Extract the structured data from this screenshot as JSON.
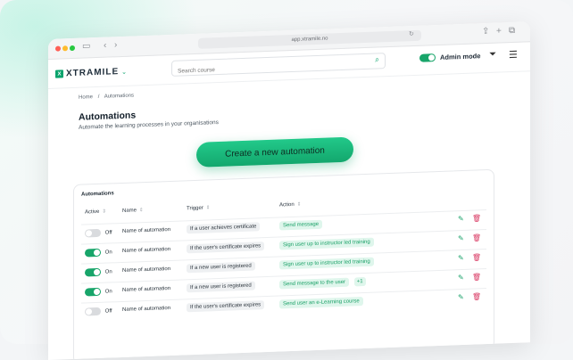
{
  "browser": {
    "url": "app.xtramile.no"
  },
  "header": {
    "logo_mark": "X",
    "logo_text": "XTRAMILE",
    "search_placeholder": "Search course",
    "admin_mode_label": "Admin mode",
    "admin_mode_on": true
  },
  "breadcrumb": {
    "home": "Home",
    "separator": "/",
    "current": "Automations"
  },
  "page": {
    "title": "Automations",
    "subtitle": "Automate the learning processes in your organisations",
    "create_button": "Create a new automation"
  },
  "table": {
    "title": "Automations",
    "columns": [
      "Active",
      "Name",
      "Trigger",
      "Action"
    ],
    "rows": [
      {
        "active": false,
        "active_label": "Off",
        "name": "Name of automation",
        "trigger": "If a user achieves certificate",
        "action": "Send message",
        "extra": ""
      },
      {
        "active": true,
        "active_label": "On",
        "name": "Name of automation",
        "trigger": "If the user's certificate expires",
        "action": "Sign user up to instructor led training",
        "extra": ""
      },
      {
        "active": true,
        "active_label": "On",
        "name": "Name of automation",
        "trigger": "If a new user is registered",
        "action": "Sign user up to instructor led training",
        "extra": ""
      },
      {
        "active": true,
        "active_label": "On",
        "name": "Name of automation",
        "trigger": "If a new user is registered",
        "action": "Send message to the user",
        "extra": "+1"
      },
      {
        "active": false,
        "active_label": "Off",
        "name": "Name of automation",
        "trigger": "If the user's certificate expires",
        "action": "Send user an e-Learning course",
        "extra": ""
      }
    ]
  },
  "colors": {
    "accent": "#18a56a",
    "delete": "#d8345f"
  }
}
